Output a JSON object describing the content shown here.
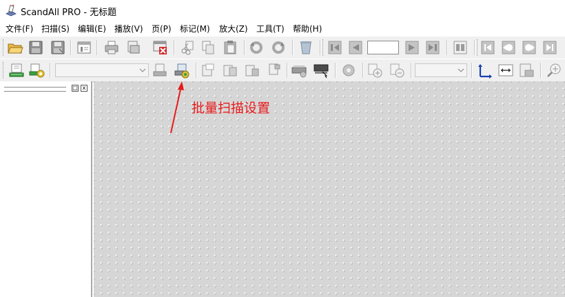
{
  "window": {
    "title": "ScandAll PRO - 无标题"
  },
  "menu": [
    {
      "label": "文件(F)"
    },
    {
      "label": "扫描(S)"
    },
    {
      "label": "编辑(E)"
    },
    {
      "label": "播放(V)"
    },
    {
      "label": "页(P)"
    },
    {
      "label": "标记(M)"
    },
    {
      "label": "放大(Z)"
    },
    {
      "label": "工具(T)"
    },
    {
      "label": "帮助(H)"
    }
  ],
  "toolbar1": {
    "icons": [
      "open-folder-icon",
      "save-icon",
      "save-as-icon",
      "properties-icon",
      "print-icon",
      "print-preview-icon",
      "delete-page-icon",
      "cut-icon",
      "copy-icon",
      "paste-icon",
      "rotate-left-icon",
      "rotate-right-icon",
      "recycle-bin-icon",
      "first-page-icon",
      "previous-page-icon",
      "next-page-icon",
      "last-page-icon",
      "thumbnail-view-icon",
      "skip-first-icon",
      "skip-back-icon",
      "play-icon",
      "skip-last-icon"
    ],
    "page_number": ""
  },
  "toolbar2": {
    "icons": [
      "scan-icon",
      "scan-settings-icon",
      "batch-scan-icon",
      "batch-scan-settings-icon",
      "split-page-icon",
      "merge-page-icon",
      "insert-page-icon",
      "replace-page-icon",
      "scanner-setup-icon",
      "scanner-select-icon",
      "image-adjust-icon",
      "zoom-page-in-icon",
      "zoom-page-out-icon",
      "coordinate-axes-icon",
      "fit-width-icon",
      "fit-page-icon",
      "zoom-in-icon"
    ],
    "profile_value": "",
    "zoom_value": ""
  },
  "annotation": {
    "text": "批量扫描设置",
    "color": "#e81a1a"
  },
  "left_panel": {
    "ctrl_restore": "□",
    "ctrl_close": "x"
  }
}
